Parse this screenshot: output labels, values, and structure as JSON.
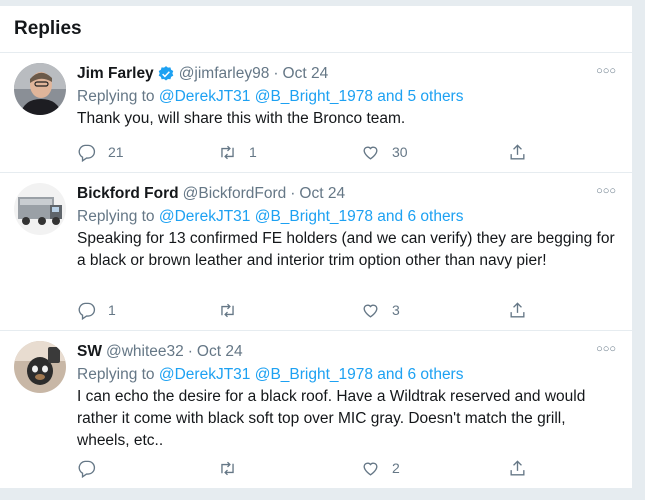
{
  "header": {
    "title": "Replies"
  },
  "tweets": [
    {
      "name": "Jim Farley",
      "verified": true,
      "handle": "@jimfarley98",
      "separator": "·",
      "date": "Oct 24",
      "replying_prefix": "Replying to",
      "replying_to": "@DerekJT31 @B_Bright_1978 and 5 others",
      "text": "Thank you, will share this with the Bronco team.",
      "reply_count": "21",
      "retweet_count": "1",
      "like_count": "30"
    },
    {
      "name": "Bickford Ford",
      "verified": false,
      "handle": "@BickfordFord",
      "separator": "·",
      "date": "Oct 24",
      "replying_prefix": "Replying to",
      "replying_to": "@DerekJT31 @B_Bright_1978 and 6 others",
      "text": "Speaking for 13 confirmed FE holders (and we can verify) they are begging for a black or brown leather and interior trim option other than navy pier!",
      "reply_count": "1",
      "retweet_count": "",
      "like_count": "3"
    },
    {
      "name": "SW",
      "verified": false,
      "handle": "@whitee32",
      "separator": "·",
      "date": "Oct 24",
      "replying_prefix": "Replying to",
      "replying_to": "@DerekJT31 @B_Bright_1978 and 6 others",
      "text": "I can echo the desire for a black roof.  Have a Wildtrak reserved and would rather it come with black soft top over MIC gray.  Doesn't match the grill, wheels, etc..",
      "reply_count": "",
      "retweet_count": "",
      "like_count": "2"
    }
  ],
  "icons": {
    "reply": "reply-icon",
    "retweet": "retweet-icon",
    "like": "heart-icon",
    "share": "share-icon",
    "more": "more-icon",
    "verified": "verified-badge-icon"
  },
  "colors": {
    "link": "#1da1f2",
    "secondary_text": "#657786",
    "primary_text": "#14171a",
    "border": "#e6ecf0"
  }
}
